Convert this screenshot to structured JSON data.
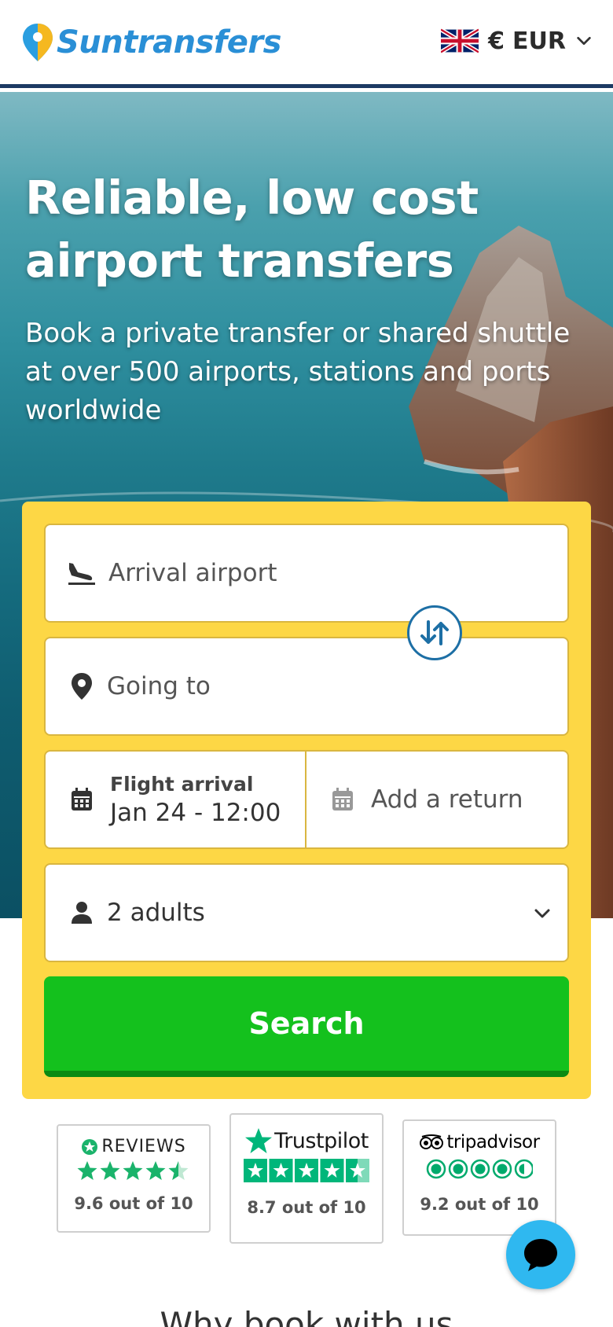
{
  "header": {
    "logo_text": "Suntransfers",
    "currency_symbol": "€",
    "currency_code": "EUR",
    "flag": "uk-flag-icon"
  },
  "hero": {
    "title": "Reliable, low cost airport transfers",
    "subtitle": "Book a private transfer or shared shuttle at over 500 airports, stations and ports worldwide"
  },
  "form": {
    "arrival_placeholder": "Arrival airport",
    "going_placeholder": "Going to",
    "date_label": "Flight arrival",
    "date_value": "Jan 24 - 12:00",
    "return_label": "Add a return",
    "passengers_value": "2 adults",
    "search_label": "Search"
  },
  "reviews": [
    {
      "brand": "REVIEWS",
      "score": "9.6 out of 10",
      "rating": 4.5,
      "color": "#1ab36b"
    },
    {
      "brand": "Trustpilot",
      "score": "8.7 out of 10",
      "rating": 4.5,
      "color": "#00b67a"
    },
    {
      "brand": "tripadvisor",
      "score": "9.2 out of 10",
      "rating": 4.5,
      "color": "#00aa6c"
    }
  ],
  "section_heading": "Why book with us",
  "colors": {
    "brand_blue": "#2a8fd6",
    "header_border": "#1c3a63",
    "card_yellow": "#fdd745",
    "search_green": "#14c11d",
    "chat_blue": "#2fb8f0"
  }
}
